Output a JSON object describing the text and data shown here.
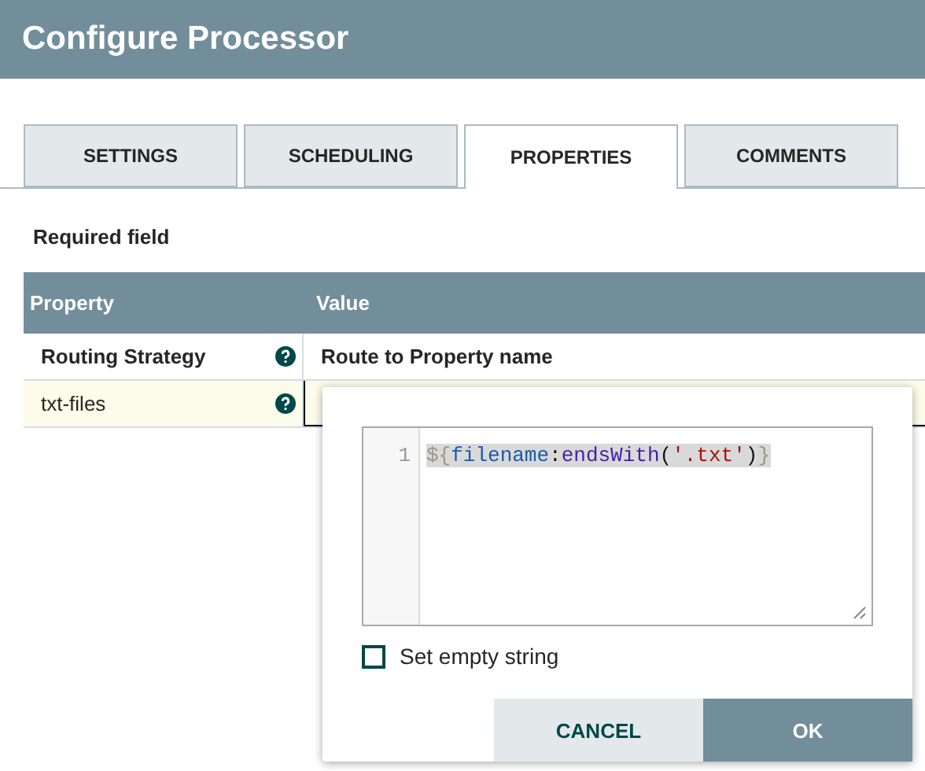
{
  "window": {
    "title": "Configure Processor"
  },
  "tabs": [
    {
      "label": "SETTINGS",
      "selected": false
    },
    {
      "label": "SCHEDULING",
      "selected": false
    },
    {
      "label": "PROPERTIES",
      "selected": true
    },
    {
      "label": "COMMENTS",
      "selected": false
    }
  ],
  "required_note": "Required field",
  "table": {
    "columns": [
      "Property",
      "Value"
    ],
    "rows": [
      {
        "property": "Routing Strategy",
        "required": true,
        "value": "Route to Property name",
        "editing": false
      },
      {
        "property": "txt-files",
        "required": false,
        "value": "",
        "editing": true
      }
    ]
  },
  "editor": {
    "line_number": "1",
    "tokens": [
      {
        "kind": "brace",
        "text": "${"
      },
      {
        "kind": "ident",
        "text": "filename"
      },
      {
        "kind": "punct",
        "text": ":"
      },
      {
        "kind": "func",
        "text": "endsWith"
      },
      {
        "kind": "punct",
        "text": "("
      },
      {
        "kind": "string",
        "text": "'.txt'"
      },
      {
        "kind": "punct",
        "text": ")"
      },
      {
        "kind": "brace",
        "text": "}"
      }
    ],
    "empty_string": {
      "label": "Set empty string",
      "checked": false
    },
    "buttons": [
      {
        "label": "CANCEL",
        "kind": "secondary"
      },
      {
        "label": "OK",
        "kind": "primary"
      }
    ]
  }
}
